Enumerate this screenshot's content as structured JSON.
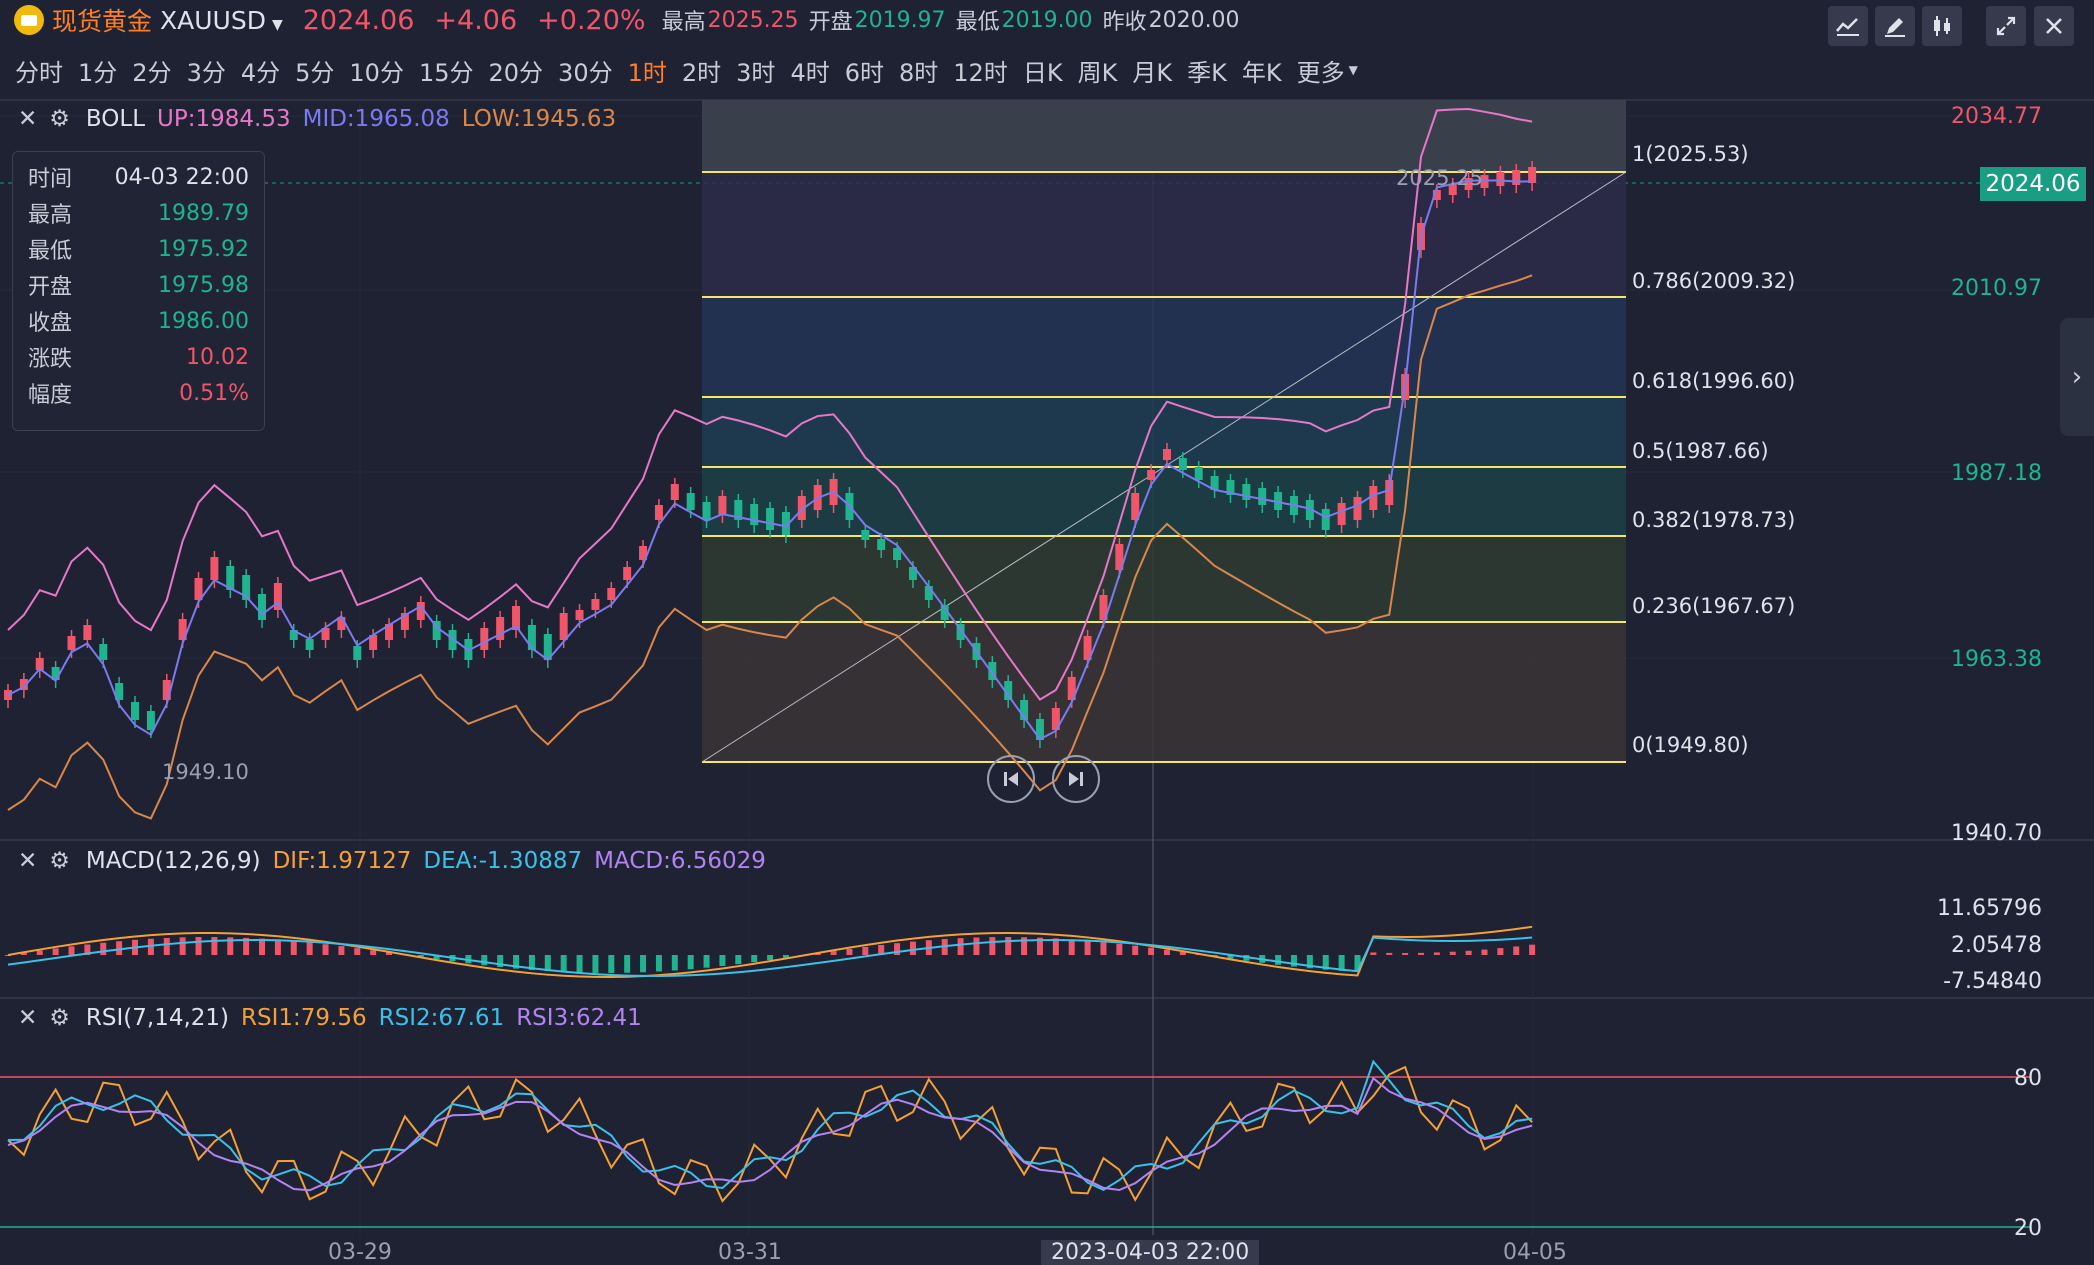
{
  "header": {
    "name": "现货黄金",
    "symbol": "XAUUSD",
    "price": "2024.06",
    "change": "+4.06",
    "change_pct": "+0.20%",
    "high_label": "最高",
    "high": "2025.25",
    "open_label": "开盘",
    "open": "2019.97",
    "low_label": "最低",
    "low": "2019.00",
    "prev_close_label": "昨收",
    "prev_close": "2020.00"
  },
  "timeframes": [
    "分时",
    "1分",
    "2分",
    "3分",
    "4分",
    "5分",
    "10分",
    "15分",
    "20分",
    "30分",
    "1时",
    "2时",
    "3时",
    "4时",
    "6时",
    "8时",
    "12时",
    "日K",
    "周K",
    "月K",
    "季K",
    "年K",
    "更多"
  ],
  "active_timeframe": "1时",
  "boll": {
    "name": "BOLL",
    "up": "UP:1984.53",
    "mid": "MID:1965.08",
    "low": "LOW:1945.63"
  },
  "tooltip": {
    "rows": [
      {
        "label": "时间",
        "value": "04-03 22:00"
      },
      {
        "label": "最高",
        "value": "1989.79"
      },
      {
        "label": "最低",
        "value": "1975.92"
      },
      {
        "label": "开盘",
        "value": "1975.98"
      },
      {
        "label": "收盘",
        "value": "1986.00"
      },
      {
        "label": "涨跌",
        "value": "10.02"
      },
      {
        "label": "幅度",
        "value": "0.51%"
      }
    ]
  },
  "price_axis": [
    "2034.77",
    "2024.06",
    "2010.97",
    "1987.18",
    "1963.38",
    "1940.70"
  ],
  "fib_levels": [
    "1(2025.53)",
    "0.786(2009.32)",
    "0.618(1996.60)",
    "0.5(1987.66)",
    "0.382(1978.73)",
    "0.236(1967.67)",
    "0(1949.80)"
  ],
  "annotations": {
    "max": "2025.25",
    "min": "1949.10"
  },
  "macd": {
    "name": "MACD(12,26,9)",
    "dif": "DIF:1.97127",
    "dea": "DEA:-1.30887",
    "macd": "MACD:6.56029",
    "axis": [
      "11.65796",
      "2.05478",
      "-7.54840"
    ]
  },
  "rsi": {
    "name": "RSI(7,14,21)",
    "rsi1": "RSI1:79.56",
    "rsi2": "RSI2:67.61",
    "rsi3": "RSI3:62.41",
    "axis": [
      "80",
      "20"
    ]
  },
  "dates": [
    "03-29",
    "03-31",
    "2023-04-03 22:00",
    "04-05"
  ],
  "colors": {
    "up": "#f0566a",
    "down": "#1fb38e",
    "boll_up": "#e678c8",
    "boll_mid": "#7b7bf0",
    "boll_low": "#d9874a",
    "fib": "#f3e66a",
    "accent": "#ff7f26",
    "dif": "#f5a035",
    "dea": "#3bc0e8",
    "macd_lbl": "#b184f0"
  },
  "icons": [
    "line-tool-icon",
    "pen-icon",
    "candle-settings-icon",
    "expand-icon",
    "close-icon",
    "chevron-right-icon",
    "prev-icon",
    "next-icon"
  ]
}
